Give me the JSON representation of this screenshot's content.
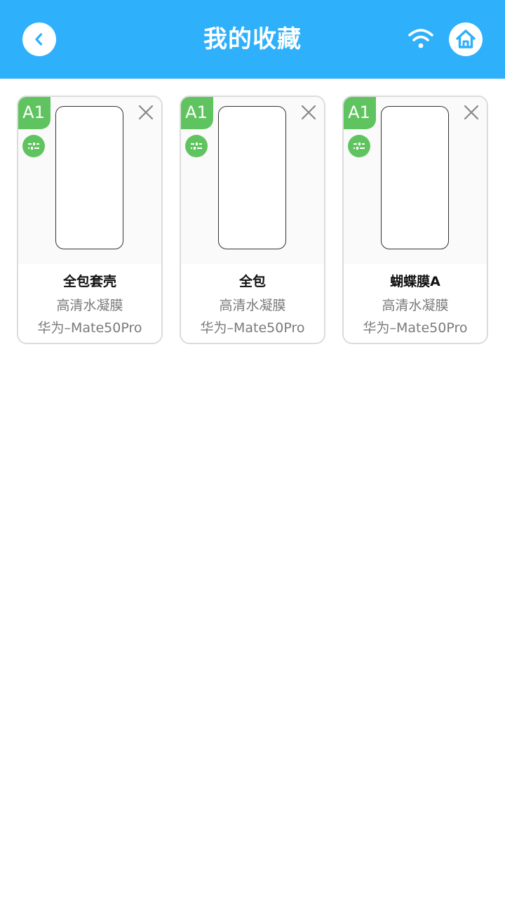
{
  "header": {
    "title": "我的收藏",
    "background_color": "#2fb0fb",
    "back_icon": "chevron-left-icon",
    "wifi_icon": "wifi-icon",
    "home_icon": "home-icon"
  },
  "favorites": [
    {
      "badge": "A1",
      "name": "全包套壳",
      "material": "高清水凝膜",
      "model": "华为–Mate50Pro"
    },
    {
      "badge": "A1",
      "name": "全包",
      "material": "高清水凝膜",
      "model": "华为–Mate50Pro"
    },
    {
      "badge": "A1",
      "name": "蝴蝶膜A",
      "material": "高清水凝膜",
      "model": "华为–Mate50Pro"
    }
  ],
  "colors": {
    "badge_green": "#5fc45f",
    "accent_blue": "#2fb0fb"
  }
}
